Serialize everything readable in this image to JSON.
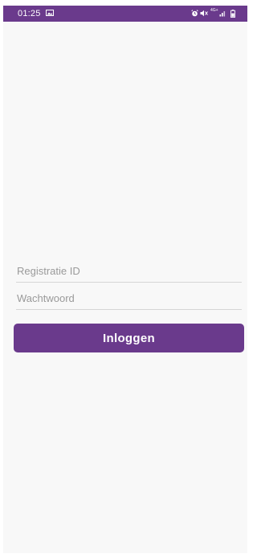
{
  "status_bar": {
    "time": "01:25",
    "network_label": "4G+",
    "icons": [
      "gallery-icon",
      "alarm-icon",
      "mute-icon",
      "network-icon",
      "signal-icon",
      "battery-icon"
    ],
    "background_color": "#6a3a8c"
  },
  "login_form": {
    "registration_placeholder": "Registratie ID",
    "password_placeholder": "Wachtwoord",
    "login_label": "Inloggen",
    "accent_color": "#6a3a8c"
  }
}
